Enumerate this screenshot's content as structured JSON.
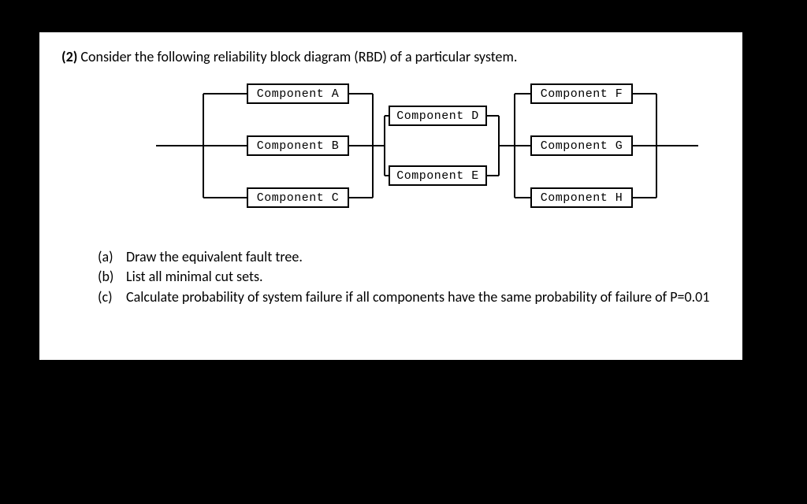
{
  "question": {
    "number": "(2)",
    "prompt": "Consider the following reliability block diagram (RBD) of a particular system."
  },
  "components": {
    "a": "Component  A",
    "b": "Component  B",
    "c": "Component  C",
    "d": "Component  D",
    "e": "Component  E",
    "f": "Component  F",
    "g": "Component  G",
    "h": "Component  H"
  },
  "parts": {
    "a": {
      "label": "(a)",
      "text": "Draw the equivalent fault tree."
    },
    "b": {
      "label": "(b)",
      "text": "List all minimal cut sets."
    },
    "c": {
      "label": "(c)",
      "text": "Calculate probability of system failure if all components have the same probability of failure of P=0.01"
    }
  }
}
